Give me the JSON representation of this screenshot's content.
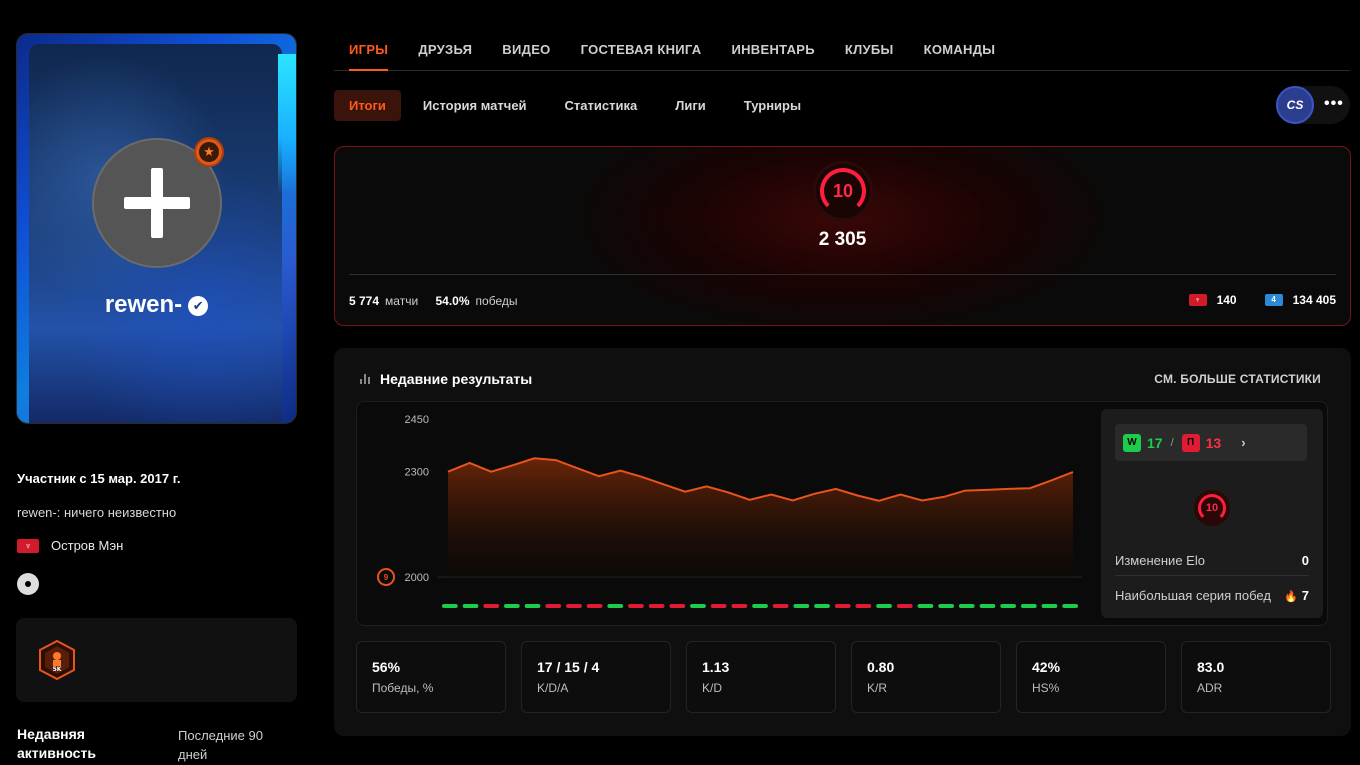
{
  "profile": {
    "nickname": "rewen-",
    "member_since": "Участник с 15 мар. 2017 г.",
    "bio": "rewen-: ничего неизвестно",
    "country": "Остров Мэн",
    "badge_label": "5K"
  },
  "recent_activity": {
    "title": "Недавняя активность",
    "period": "Последние 90 дней"
  },
  "top_nav": [
    "ИГРЫ",
    "ДРУЗЬЯ",
    "ВИДЕО",
    "ГОСТЕВАЯ КНИГА",
    "ИНВЕНТАРЬ",
    "КЛУБЫ",
    "КОМАНДЫ"
  ],
  "sub_nav": [
    "Итоги",
    "История матчей",
    "Статистика",
    "Лиги",
    "Турниры"
  ],
  "game_logo": "CS",
  "more_icon": "•••",
  "level_card": {
    "level": "10",
    "elo": "2 305",
    "matches_value": "5 774",
    "matches_label": "матчи",
    "winrate_value": "54.0%",
    "winrate_label": "победы",
    "country_rank": "140",
    "region_rank": "134 405",
    "country_flag_glyph": "♆",
    "region_flag_glyph": "4"
  },
  "recent": {
    "title": "Недавние результаты",
    "more_stats": "СМ. БОЛЬШЕ СТАТИСТИКИ",
    "wins_badge": "W",
    "wins": "17",
    "slash": "/",
    "losses_badge": "П",
    "losses": "13",
    "elo_change_label": "Изменение Elo",
    "elo_change_value": "0",
    "streak_label": "Наибольшая серия побед",
    "streak_value": "7",
    "side_level": "10"
  },
  "chart_data": {
    "type": "area",
    "y_ticks": [
      "2450",
      "2300",
      "2000"
    ],
    "ylim": [
      2000,
      2450
    ],
    "values": [
      2300,
      2325,
      2300,
      2318,
      2338,
      2333,
      2310,
      2287,
      2303,
      2285,
      2264,
      2243,
      2258,
      2241,
      2220,
      2235,
      2218,
      2237,
      2251,
      2232,
      2217,
      2235,
      2218,
      2228,
      2246,
      2248,
      2251,
      2253,
      2275,
      2299
    ],
    "results": [
      "W",
      "W",
      "L",
      "W",
      "W",
      "L",
      "L",
      "L",
      "W",
      "L",
      "L",
      "L",
      "W",
      "L",
      "L",
      "W",
      "L",
      "W",
      "W",
      "L",
      "L",
      "W",
      "L",
      "W",
      "W",
      "W",
      "W",
      "W",
      "W",
      "W",
      "W"
    ],
    "bottom_level_marker": "9",
    "colors": {
      "line": "#e8541c",
      "win": "#1ccc4a",
      "loss": "#e01c35"
    }
  },
  "stats": [
    {
      "value": "56%",
      "label": "Победы, %"
    },
    {
      "value": "17 / 15 / 4",
      "label": "K/D/A"
    },
    {
      "value": "1.13",
      "label": "K/D"
    },
    {
      "value": "0.80",
      "label": "K/R"
    },
    {
      "value": "42%",
      "label": "HS%"
    },
    {
      "value": "83.0",
      "label": "ADR"
    }
  ]
}
